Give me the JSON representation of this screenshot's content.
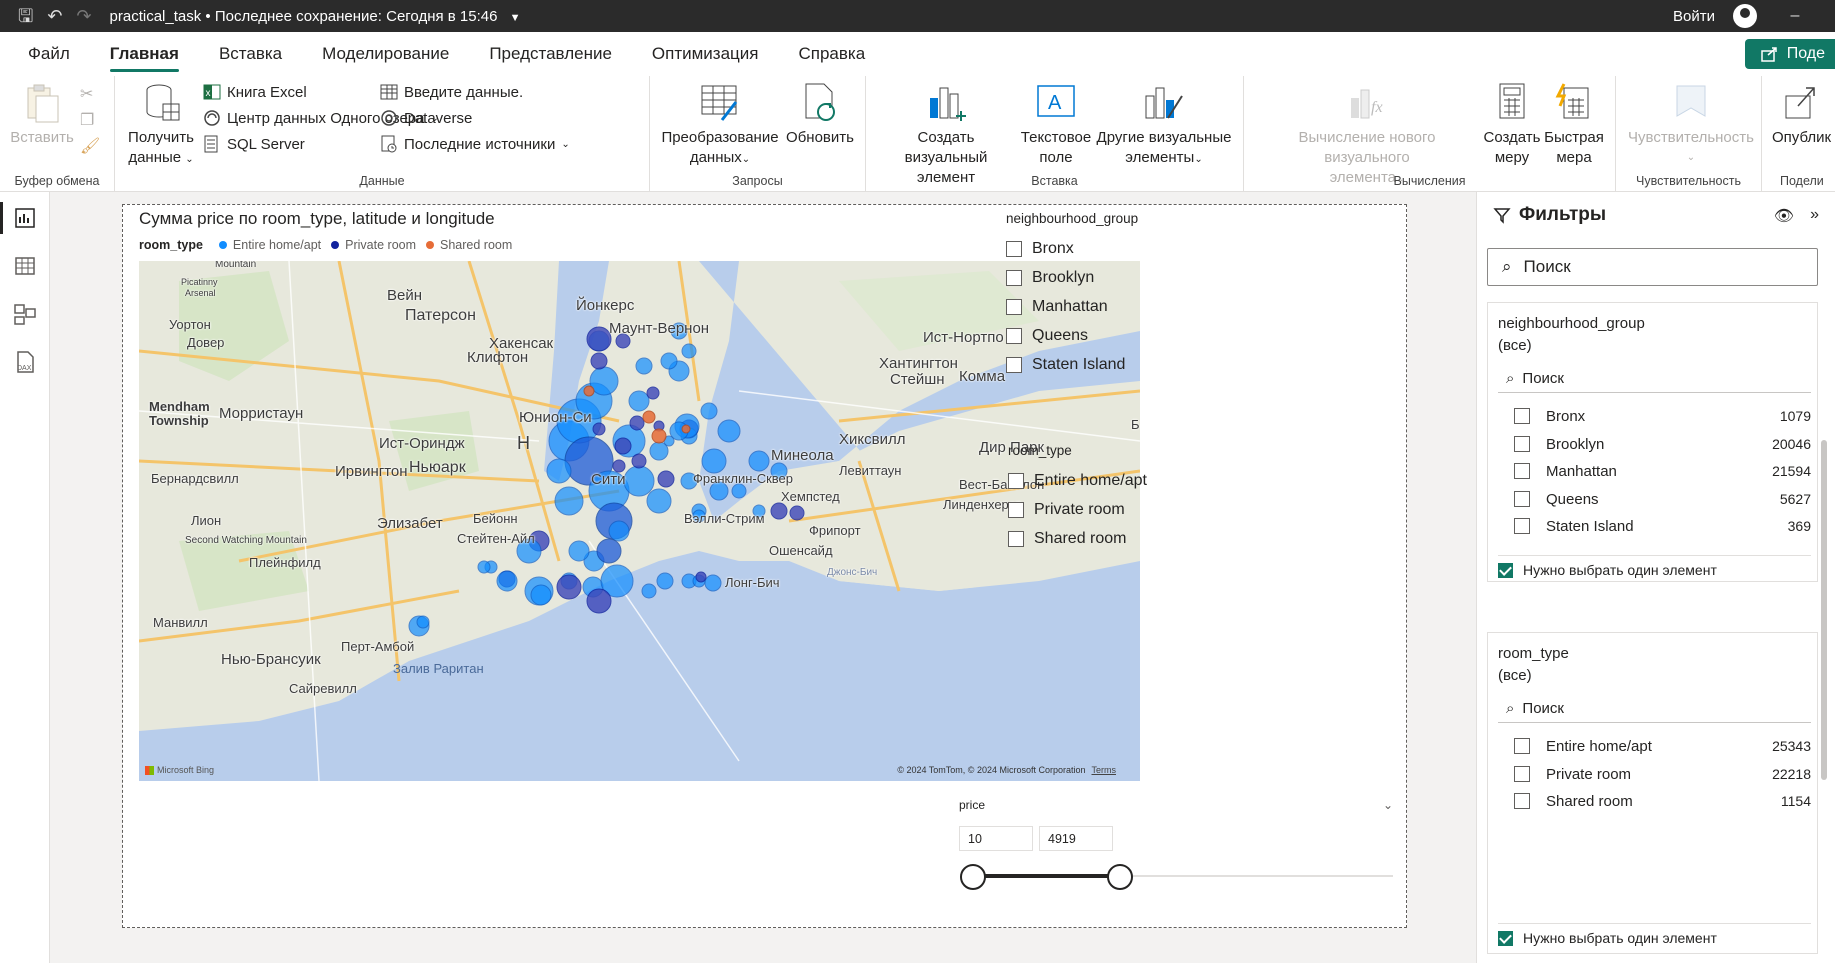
{
  "titlebar": {
    "doc_title": "practical_task",
    "save_status": "Последнее сохранение: Сегодня в 15:46",
    "signin": "Войти",
    "minimize": "–"
  },
  "tabs": [
    "Файл",
    "Главная",
    "Вставка",
    "Моделирование",
    "Представление",
    "Оптимизация",
    "Справка"
  ],
  "share_label": "Поде",
  "ribbon": {
    "clipboard": {
      "paste": "Вставить",
      "group": "Буфер обмена"
    },
    "data": {
      "get_data_1": "Получить",
      "get_data_2": "данные",
      "excel": "Книга Excel",
      "onelake": "Центр данных Одного озера",
      "sql": "SQL Server",
      "enter_data": "Введите данные.",
      "dataverse": "Dataverse",
      "recent": "Последние источники",
      "group": "Данные"
    },
    "queries": {
      "transform_1": "Преобразование",
      "transform_2": "данных",
      "refresh": "Обновить",
      "group": "Запросы"
    },
    "insert": {
      "new_visual_1": "Создать визуальный",
      "new_visual_2": "элемент",
      "textbox_1": "Текстовое",
      "textbox_2": "поле",
      "more_visuals_1": "Другие визуальные",
      "more_visuals_2": "элементы",
      "group": "Вставка"
    },
    "calculations": {
      "new_calc_1": "Вычисление нового визуального",
      "new_calc_2": "элемента",
      "new_measure_1": "Создать",
      "new_measure_2": "меру",
      "quick_measure_1": "Быстрая",
      "quick_measure_2": "мера",
      "group": "Вычисления"
    },
    "sensitivity": {
      "label": "Чувствительность",
      "group": "Чувствительность"
    },
    "share": {
      "publish": "Опублик",
      "group": "Подели"
    }
  },
  "visual": {
    "title": "Сумма price по room_type, latitude и longitude",
    "legend_title": "room_type",
    "legend": [
      {
        "label": "Entire home/apt",
        "color": "#118dff"
      },
      {
        "label": "Private room",
        "color": "#12239e"
      },
      {
        "label": "Shared room",
        "color": "#e66c37"
      }
    ],
    "map_labels": [
      "Вейн",
      "Патерсон",
      "Йонкерс",
      "Маунт-Вернон",
      "Ист-Нортпо",
      "Хантингтон",
      "Стейшн",
      "Комма",
      "Уортон",
      "Довер",
      "Хакенсак",
      "Клифтон",
      "Mendham",
      "Township",
      "Морристаун",
      "Юнион-Си",
      "Ист-Ориндж",
      "Хиксвилл",
      "Дир Парк",
      "Минеола",
      "Ирвингтон",
      "Ньюарк",
      "Бернардсвилл",
      "Сити",
      "Франклин-Сквер",
      "Левиттаун",
      "Хемпстед",
      "Вест-Бабилон",
      "Линденхерст",
      "Лион",
      "Second Watching Mountain",
      "Элизабет",
      "Бейонн",
      "Стейтен-Айл",
      "Вэлли-Стрим",
      "Фрипорт",
      "Плейнфилд",
      "Ошенсайд",
      "Лонг-Бич",
      "Джонс-Бич",
      "Манвилл",
      "Перт-Амбой",
      "Нью-Брансуик",
      "Залив Раритан",
      "Сайревилл",
      "Picatinny",
      "Arsenal",
      "Mountain",
      "Н",
      "Б"
    ],
    "map_copyright": "© 2024 TomTom, © 2024 Microsoft Corporation",
    "map_terms": "Terms",
    "map_bing": "Microsoft Bing"
  },
  "slicer_neighbourhood": {
    "header": "neighbourhood_group",
    "items": [
      "Bronx",
      "Brooklyn",
      "Manhattan",
      "Queens",
      "Staten Island"
    ]
  },
  "slicer_room": {
    "header": "room_type",
    "items": [
      "Entire home/apt",
      "Private room",
      "Shared room"
    ]
  },
  "price_slicer": {
    "label": "price",
    "min": "10",
    "max": "4919",
    "low_fraction": 0.0,
    "high_fraction": 0.35
  },
  "filters": {
    "title": "Фильтры",
    "search_placeholder": "Поиск",
    "cards": [
      {
        "field": "neighbourhood_group",
        "state": "(все)",
        "search": "Поиск",
        "items": [
          {
            "label": "Bronx",
            "count": "1079"
          },
          {
            "label": "Brooklyn",
            "count": "20046"
          },
          {
            "label": "Manhattan",
            "count": "21594"
          },
          {
            "label": "Queens",
            "count": "5627"
          },
          {
            "label": "Staten Island",
            "count": "369"
          }
        ],
        "single_select": "Нужно выбрать один элемент"
      },
      {
        "field": "room_type",
        "state": "(все)",
        "search": "Поиск",
        "items": [
          {
            "label": "Entire home/apt",
            "count": "25343"
          },
          {
            "label": "Private room",
            "count": "22218"
          },
          {
            "label": "Shared room",
            "count": "1154"
          }
        ],
        "single_select": "Нужно выбрать один элемент"
      }
    ]
  }
}
